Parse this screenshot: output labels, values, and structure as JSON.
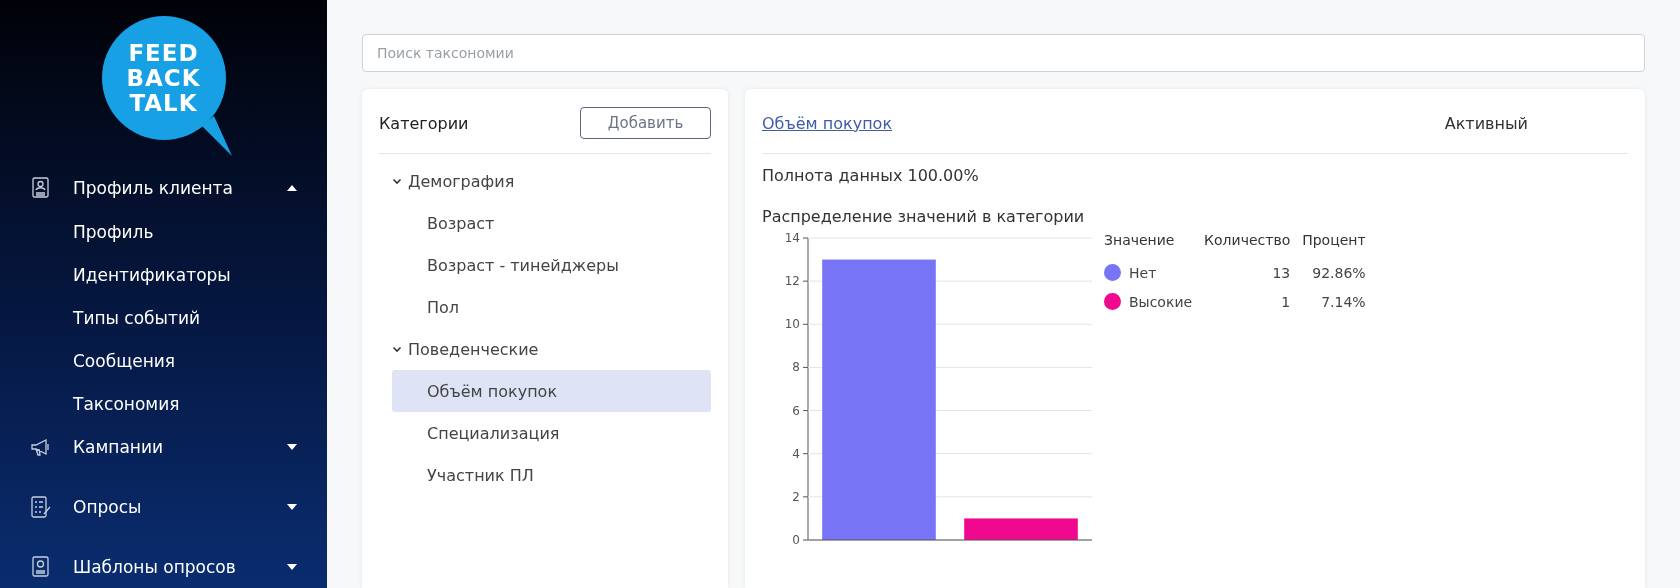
{
  "sidebar": {
    "logo": [
      "FEED",
      "BACK",
      "TALK"
    ],
    "menu": [
      {
        "label": "Профиль клиента",
        "expanded": true,
        "children": [
          {
            "label": "Профиль"
          },
          {
            "label": "Идентификаторы"
          },
          {
            "label": "Типы событий"
          },
          {
            "label": "Сообщения"
          },
          {
            "label": "Таксономия"
          }
        ]
      },
      {
        "label": "Кампании",
        "expanded": false
      },
      {
        "label": "Опросы",
        "expanded": false
      },
      {
        "label": "Шаблоны опросов",
        "expanded": false
      }
    ]
  },
  "search": {
    "placeholder": "Поиск таксономии"
  },
  "categories": {
    "title": "Категории",
    "add_button": "Добавить",
    "tree": [
      {
        "label": "Демография",
        "expanded": true,
        "selected": false,
        "children": [
          {
            "label": "Возраст",
            "selected": false
          },
          {
            "label": "Возраст - тинейджеры",
            "selected": false
          },
          {
            "label": "Пол",
            "selected": false
          }
        ]
      },
      {
        "label": "Поведенческие",
        "expanded": true,
        "selected": false,
        "children": [
          {
            "label": "Объём покупок",
            "selected": true
          },
          {
            "label": "Специализация",
            "selected": false
          },
          {
            "label": "Участник ПЛ",
            "selected": false
          }
        ]
      }
    ]
  },
  "detail": {
    "title": "Объём покупок",
    "status": "Активный",
    "completeness": "Полнота данных 100.00%",
    "distribution_title": "Распределение значений в категории",
    "chart_data": {
      "type": "bar",
      "values": [
        13,
        1
      ],
      "ylim": [
        0,
        14
      ],
      "grid": true,
      "yticks": [
        0,
        2,
        4,
        6,
        8,
        10,
        12,
        14
      ]
    },
    "table": {
      "columns": [
        "Значение",
        "Количество",
        "Процент"
      ],
      "rows": [
        {
          "value": "Нет",
          "count": "13",
          "percent": "92.86%",
          "color": "#7775f5"
        },
        {
          "value": "Высокие",
          "count": "1",
          "percent": "7.14%",
          "color": "#f0088f"
        }
      ]
    }
  }
}
